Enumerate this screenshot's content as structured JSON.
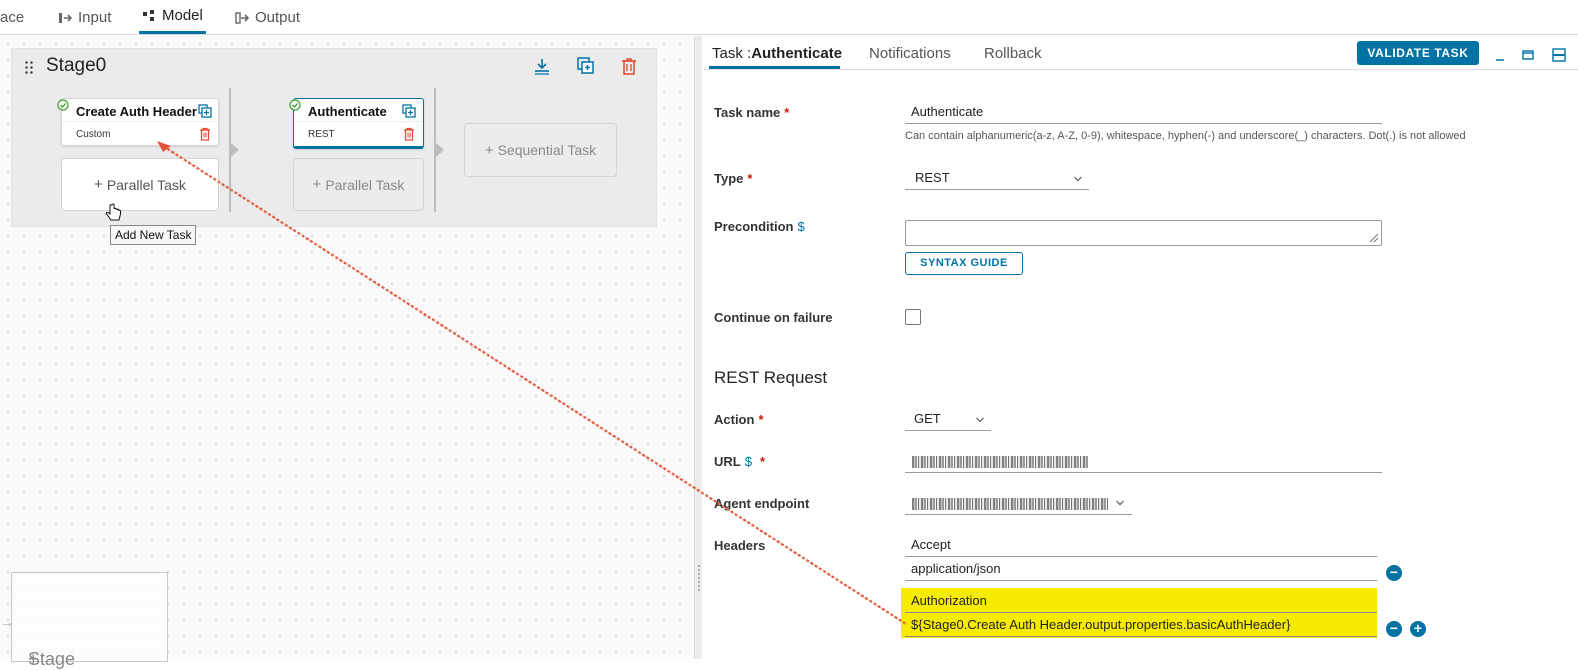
{
  "top_tabs": [
    {
      "label": "ace"
    },
    {
      "label": "Input"
    },
    {
      "label": "Model",
      "active": true
    },
    {
      "label": "Output"
    }
  ],
  "stage": {
    "title": "Stage0",
    "tasks": [
      {
        "name": "Create Auth Header",
        "type": "Custom",
        "status": "ok"
      },
      {
        "name": "Authenticate",
        "type": "REST",
        "status": "ok",
        "selected": true
      }
    ],
    "add_parallel_label": "Parallel Task",
    "add_sequential_label": "Sequential Task",
    "tooltip": "Add New Task"
  },
  "add_stage_label": "Stage",
  "panel": {
    "tab_prefix": "Task :",
    "tab_task_name": "Authenticate",
    "tabs": [
      "Notifications",
      "Rollback"
    ],
    "validate_label": "VALIDATE TASK",
    "task_name_label": "Task name",
    "task_name_value": "Authenticate",
    "task_name_hint": "Can contain alphanumeric(a-z, A-Z, 0-9), whitespace, hyphen(-) and underscore(_) characters. Dot(.) is not allowed",
    "type_label": "Type",
    "type_value": "REST",
    "precondition_label": "Precondition",
    "syntax_guide_label": "SYNTAX GUIDE",
    "continue_label": "Continue on failure",
    "rest_section": "REST Request",
    "action_label": "Action",
    "action_value": "GET",
    "url_label": "URL",
    "agent_label": "Agent endpoint",
    "headers_label": "Headers",
    "headers": [
      {
        "key": "Accept",
        "value": "application/json"
      },
      {
        "key": "Authorization",
        "value": "${Stage0.Create Auth Header.output.properties.basicAuthHeader}",
        "highlighted": true
      }
    ]
  },
  "colors": {
    "accent": "#0072a3",
    "delete": "#e5472f",
    "success": "#3a9f2a",
    "highlight": "#f7ec00",
    "annotation_arrow": "#e0563b"
  }
}
